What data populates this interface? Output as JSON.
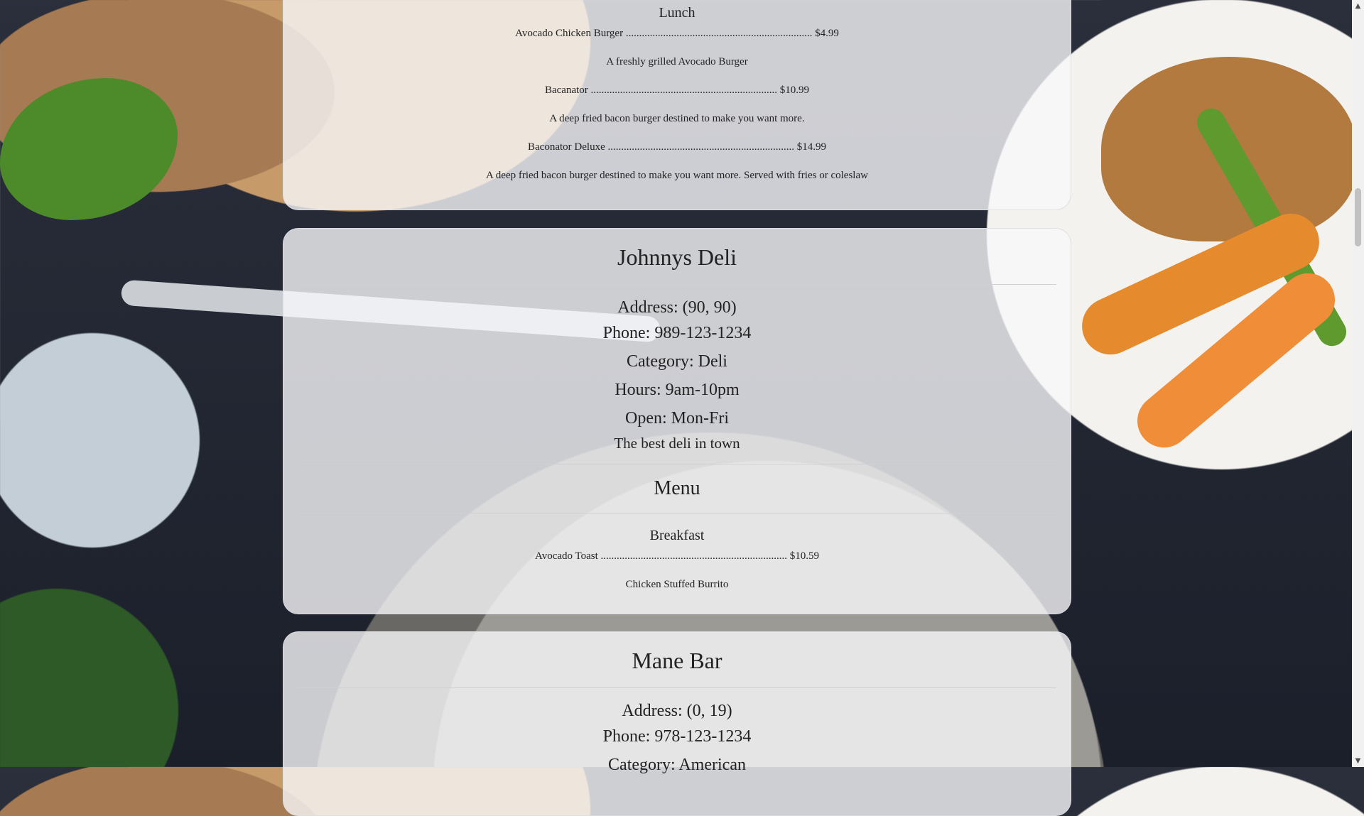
{
  "restaurant1": {
    "section_lunch": "Lunch",
    "items": [
      {
        "name": "Avocado Chicken Burger",
        "price": "$4.99",
        "dots": "......................................................................",
        "desc": "A freshly grilled Avocado Burger"
      },
      {
        "name": "Bacanator",
        "price": "$10.99",
        "dots": "......................................................................",
        "desc": "A deep fried bacon burger destined to make you want more."
      },
      {
        "name": "Baconator Deluxe",
        "price": "$14.99",
        "dots": "......................................................................",
        "desc": "A deep fried bacon burger destined to make you want more. Served with fries or coleslaw"
      }
    ]
  },
  "restaurant2": {
    "name": "Johnnys Deli",
    "address": "Address: (90, 90)",
    "phone": "Phone: 989-123-1234",
    "category": "Category: Deli",
    "hours": "Hours: 9am-10pm",
    "open": "Open: Mon-Fri",
    "description": "The best deli in town",
    "menu_title": "Menu",
    "section_breakfast": "Breakfast",
    "items": [
      {
        "name": "Avocado Toast",
        "price": "$10.59",
        "dots": "......................................................................"
      },
      {
        "name": "Chicken Stuffed Burrito"
      }
    ]
  },
  "restaurant3": {
    "name": "Mane Bar",
    "address": "Address: (0, 19)",
    "phone": "Phone: 978-123-1234",
    "category": "Category: American"
  },
  "scrollbar": {
    "up_icon": "▲",
    "down_icon": "▼"
  }
}
